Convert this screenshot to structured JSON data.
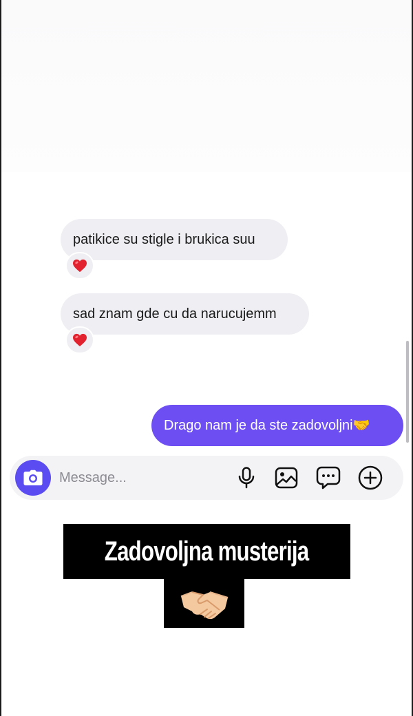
{
  "conversation": {
    "incoming": [
      {
        "text": "patikice su stigle i brukica suu",
        "reaction": "heart"
      },
      {
        "text": "sad znam gde cu da narucujemm",
        "reaction": "heart"
      }
    ],
    "outgoing": [
      {
        "text": "Drago nam je da ste zadovoljni🤝"
      }
    ]
  },
  "composer": {
    "placeholder": "Message...",
    "icons": [
      "camera-icon",
      "microphone-icon",
      "gallery-icon",
      "sticker-icon",
      "add-icon"
    ]
  },
  "overlay": {
    "caption": "Zadovoljna musterija",
    "emoji": "handshake"
  },
  "colors": {
    "accent": "#6c4ef3",
    "camera": "#5a4cf0",
    "bubble_in": "#efeff3",
    "heart": "#e2232f"
  }
}
